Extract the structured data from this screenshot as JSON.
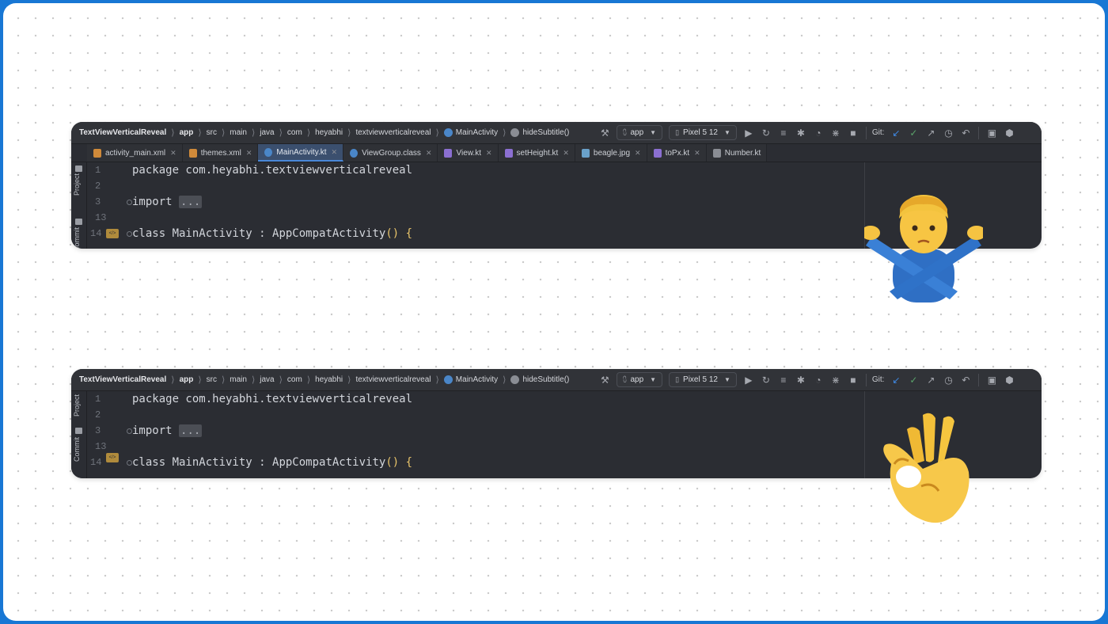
{
  "navbar": {
    "crumbs": [
      "TextViewVerticalReveal",
      "app",
      "src",
      "main",
      "java",
      "com",
      "heyabhi",
      "textviewverticalreveal",
      "MainActivity",
      "hideSubtitle()"
    ],
    "run_config": "app",
    "device": "Pixel 5 12",
    "git_label": "Git:"
  },
  "tabs": [
    {
      "label": "activity_main.xml",
      "icon": "xml-file-icon",
      "active": false
    },
    {
      "label": "themes.xml",
      "icon": "xml-file-icon",
      "active": false
    },
    {
      "label": "MainActivity.kt",
      "icon": "class-icon",
      "active": true
    },
    {
      "label": "ViewGroup.class",
      "icon": "class-icon",
      "active": false
    },
    {
      "label": "View.kt",
      "icon": "kotlin-file-icon",
      "active": false
    },
    {
      "label": "setHeight.kt",
      "icon": "kotlin-file-icon",
      "active": false
    },
    {
      "label": "beagle.jpg",
      "icon": "image-file-icon",
      "active": false
    },
    {
      "label": "toPx.kt",
      "icon": "kotlin-file-icon",
      "active": false
    },
    {
      "label": "Number.kt",
      "icon": "gear-file-icon",
      "active": false
    }
  ],
  "sidebar": {
    "project": "Project",
    "commit": "Commit"
  },
  "code": {
    "lines": [
      {
        "num": "1",
        "text": "package com.heyabhi.textviewverticalreveal"
      },
      {
        "num": "2",
        "text": ""
      },
      {
        "num": "3",
        "text_kw": "import",
        "text_folded": "..."
      },
      {
        "num": "13",
        "text": ""
      },
      {
        "num": "14",
        "text_pre": "class MainActivity : ",
        "text_super": "AppCompatActivity",
        "text_post": "() {"
      }
    ]
  },
  "emojis": {
    "top": "🙅‍♂️",
    "bottom": "👌"
  },
  "colors": {
    "frame": "#1877d4",
    "editor_bg": "#2b2d33",
    "active_tab": "#3b4f6e",
    "accent": "#4a88d8"
  }
}
